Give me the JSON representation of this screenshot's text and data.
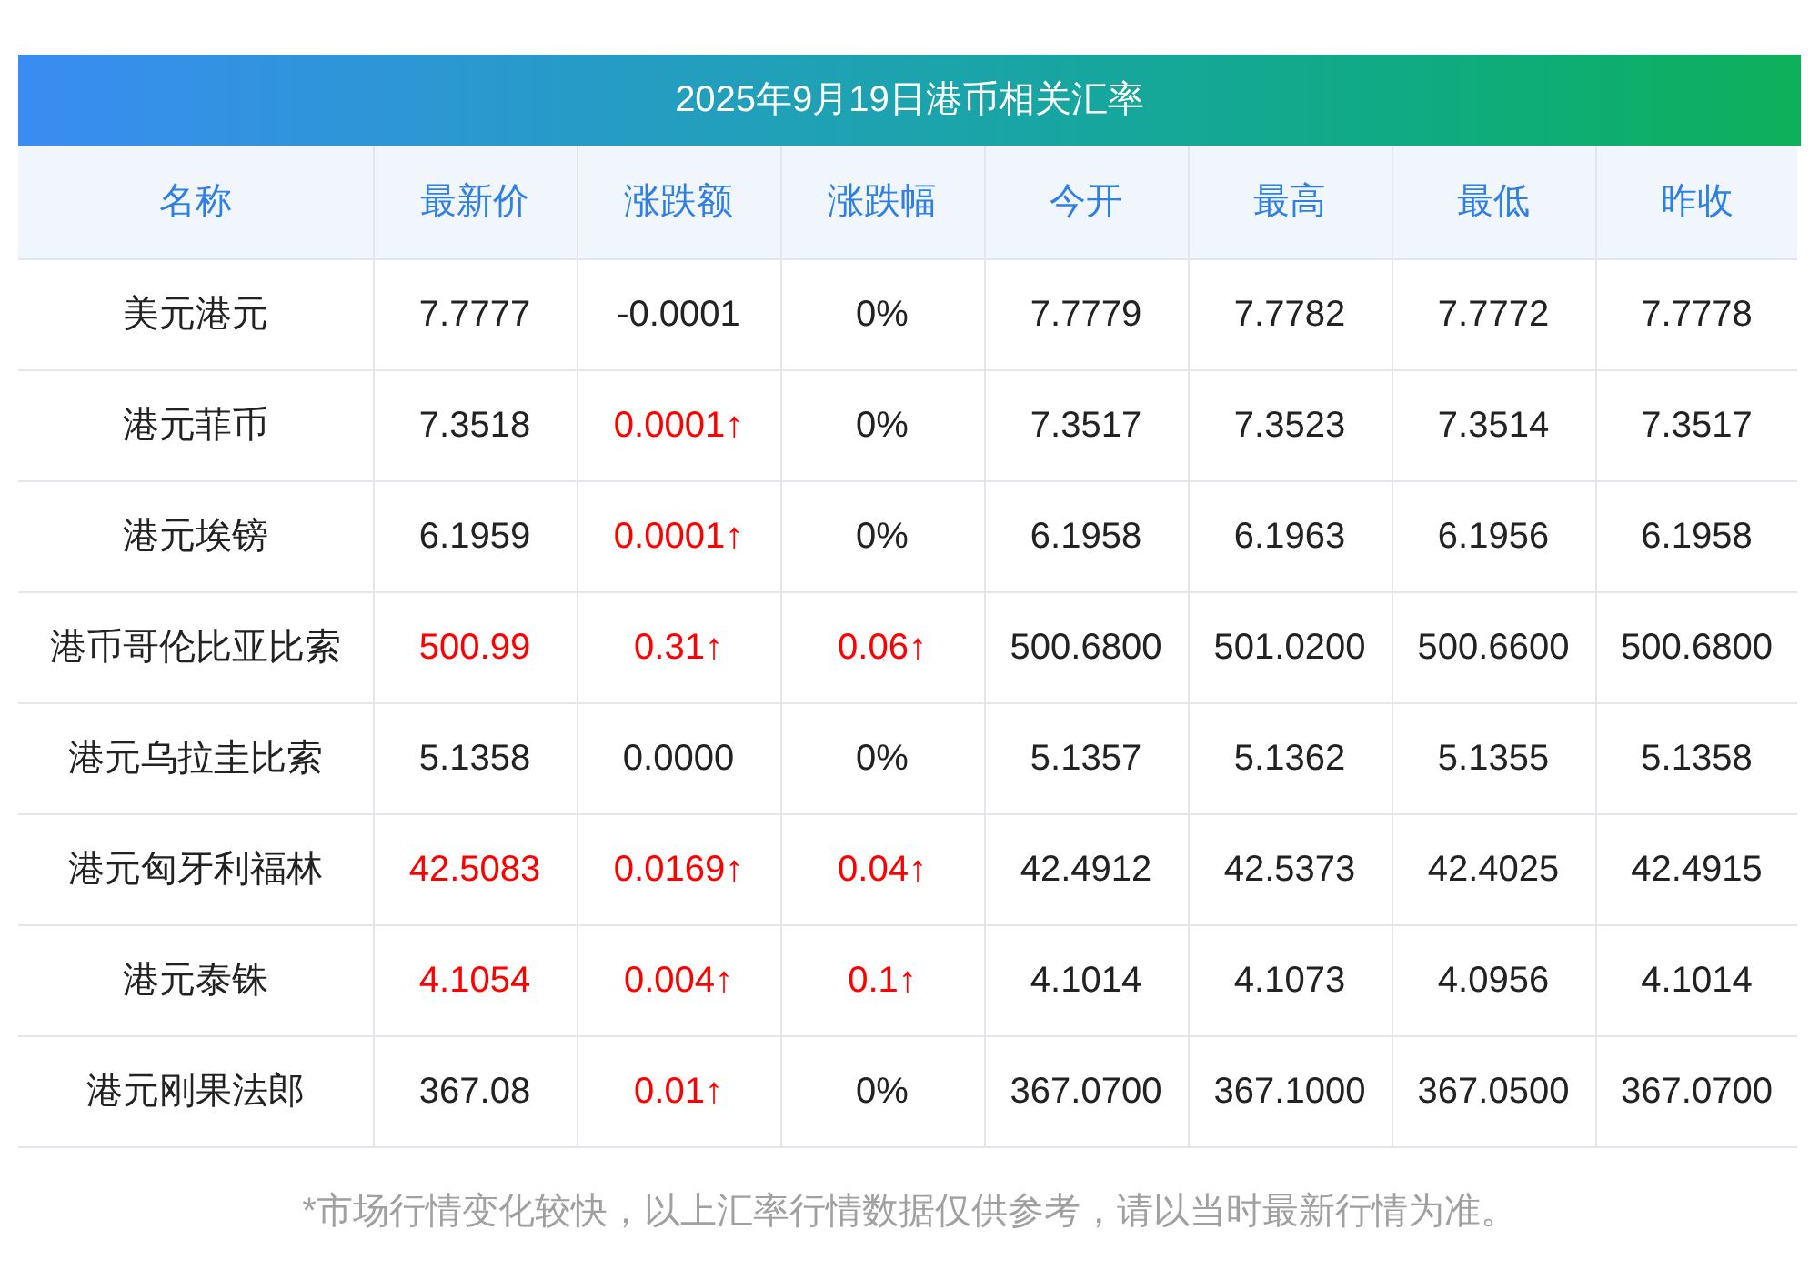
{
  "table": {
    "title": "2025年9月19日港币相关汇率",
    "columns": [
      "名称",
      "最新价",
      "涨跌额",
      "涨跌幅",
      "今开",
      "最高",
      "最低",
      "昨收"
    ],
    "rows": [
      [
        {
          "text": "美元港元",
          "rising": false
        },
        {
          "text": "7.7777",
          "rising": false
        },
        {
          "text": "-0.0001",
          "rising": false
        },
        {
          "text": "0%",
          "rising": false
        },
        {
          "text": "7.7779",
          "rising": false
        },
        {
          "text": "7.7782",
          "rising": false
        },
        {
          "text": "7.7772",
          "rising": false
        },
        {
          "text": "7.7778",
          "rising": false
        }
      ],
      [
        {
          "text": "港元菲币",
          "rising": false
        },
        {
          "text": "7.3518",
          "rising": false
        },
        {
          "text": "0.0001↑",
          "rising": true
        },
        {
          "text": "0%",
          "rising": false
        },
        {
          "text": "7.3517",
          "rising": false
        },
        {
          "text": "7.3523",
          "rising": false
        },
        {
          "text": "7.3514",
          "rising": false
        },
        {
          "text": "7.3517",
          "rising": false
        }
      ],
      [
        {
          "text": "港元埃镑",
          "rising": false
        },
        {
          "text": "6.1959",
          "rising": false
        },
        {
          "text": "0.0001↑",
          "rising": true
        },
        {
          "text": "0%",
          "rising": false
        },
        {
          "text": "6.1958",
          "rising": false
        },
        {
          "text": "6.1963",
          "rising": false
        },
        {
          "text": "6.1956",
          "rising": false
        },
        {
          "text": "6.1958",
          "rising": false
        }
      ],
      [
        {
          "text": "港币哥伦比亚比索",
          "rising": false
        },
        {
          "text": "500.99",
          "rising": true
        },
        {
          "text": "0.31↑",
          "rising": true
        },
        {
          "text": "0.06↑",
          "rising": true
        },
        {
          "text": "500.6800",
          "rising": false
        },
        {
          "text": "501.0200",
          "rising": false
        },
        {
          "text": "500.6600",
          "rising": false
        },
        {
          "text": "500.6800",
          "rising": false
        }
      ],
      [
        {
          "text": "港元乌拉圭比索",
          "rising": false
        },
        {
          "text": "5.1358",
          "rising": false
        },
        {
          "text": "0.0000",
          "rising": false
        },
        {
          "text": "0%",
          "rising": false
        },
        {
          "text": "5.1357",
          "rising": false
        },
        {
          "text": "5.1362",
          "rising": false
        },
        {
          "text": "5.1355",
          "rising": false
        },
        {
          "text": "5.1358",
          "rising": false
        }
      ],
      [
        {
          "text": "港元匈牙利福林",
          "rising": false
        },
        {
          "text": "42.5083",
          "rising": true
        },
        {
          "text": "0.0169↑",
          "rising": true
        },
        {
          "text": "0.04↑",
          "rising": true
        },
        {
          "text": "42.4912",
          "rising": false
        },
        {
          "text": "42.5373",
          "rising": false
        },
        {
          "text": "42.4025",
          "rising": false
        },
        {
          "text": "42.4915",
          "rising": false
        }
      ],
      [
        {
          "text": "港元泰铢",
          "rising": false
        },
        {
          "text": "4.1054",
          "rising": true
        },
        {
          "text": "0.004↑",
          "rising": true
        },
        {
          "text": "0.1↑",
          "rising": true
        },
        {
          "text": "4.1014",
          "rising": false
        },
        {
          "text": "4.1073",
          "rising": false
        },
        {
          "text": "4.0956",
          "rising": false
        },
        {
          "text": "4.1014",
          "rising": false
        }
      ],
      [
        {
          "text": "港元刚果法郎",
          "rising": false
        },
        {
          "text": "367.08",
          "rising": false
        },
        {
          "text": "0.01↑",
          "rising": true
        },
        {
          "text": "0%",
          "rising": false
        },
        {
          "text": "367.0700",
          "rising": false
        },
        {
          "text": "367.1000",
          "rising": false
        },
        {
          "text": "367.0500",
          "rising": false
        },
        {
          "text": "367.0700",
          "rising": false
        }
      ]
    ],
    "footnote": "*市场行情变化较快，以上汇率行情数据仅供参考，请以当时最新行情为准。"
  }
}
